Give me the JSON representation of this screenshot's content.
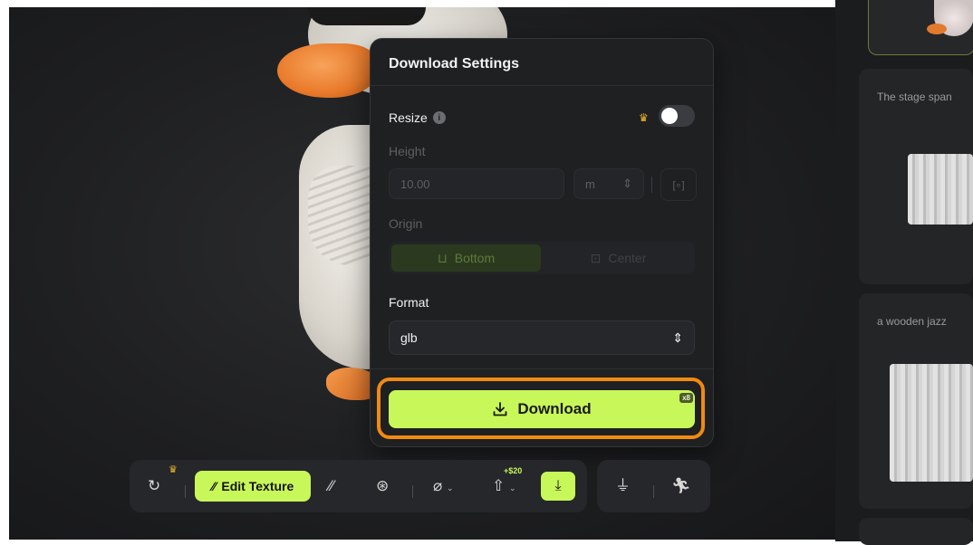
{
  "popup": {
    "title": "Download Settings",
    "resize_label": "Resize",
    "resize_enabled": true,
    "height_label": "Height",
    "height_value": "10.00",
    "unit": "m",
    "origin_label": "Origin",
    "origin_options": [
      "Bottom",
      "Center"
    ],
    "origin_selected": "Bottom",
    "format_label": "Format",
    "format_value": "glb",
    "download_label": "Download",
    "download_badge": "x8"
  },
  "toolbar": {
    "edit_texture_label": "Edit Texture",
    "price_tag": "+$20"
  },
  "right_panel": {
    "cards": [
      {
        "label": "The stage span"
      },
      {
        "label": "a wooden jazz"
      }
    ]
  },
  "colors": {
    "accent": "#c8f75a",
    "highlight": "#f08a10",
    "premium": "#f3b62a"
  }
}
